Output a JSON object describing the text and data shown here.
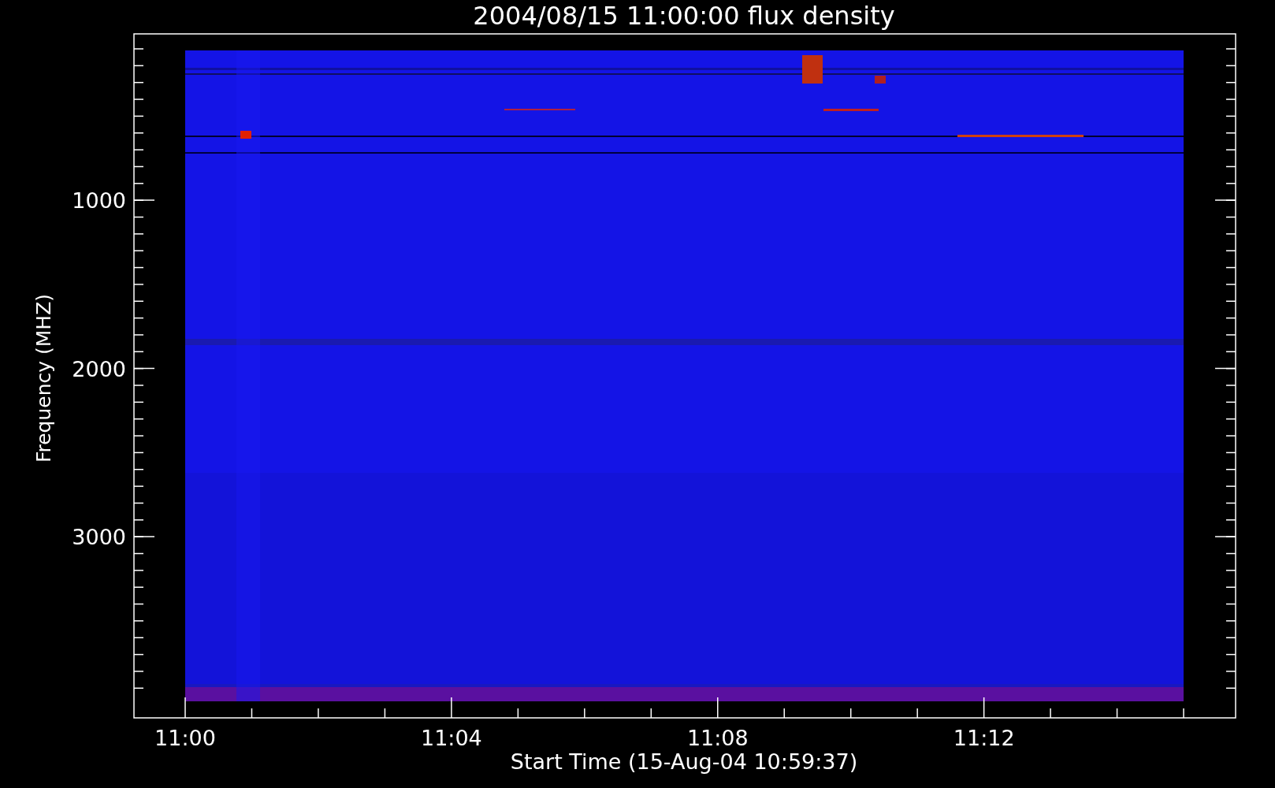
{
  "title": "2004/08/15 11:00:00 flux density",
  "ylabel": "Frequency (MHZ)",
  "xlabel": "Start Time (15-Aug-04 10:59:37)",
  "yticks": [
    "1000",
    "2000",
    "3000"
  ],
  "xticks": [
    "11:00",
    "11:04",
    "11:08",
    "11:12"
  ]
}
